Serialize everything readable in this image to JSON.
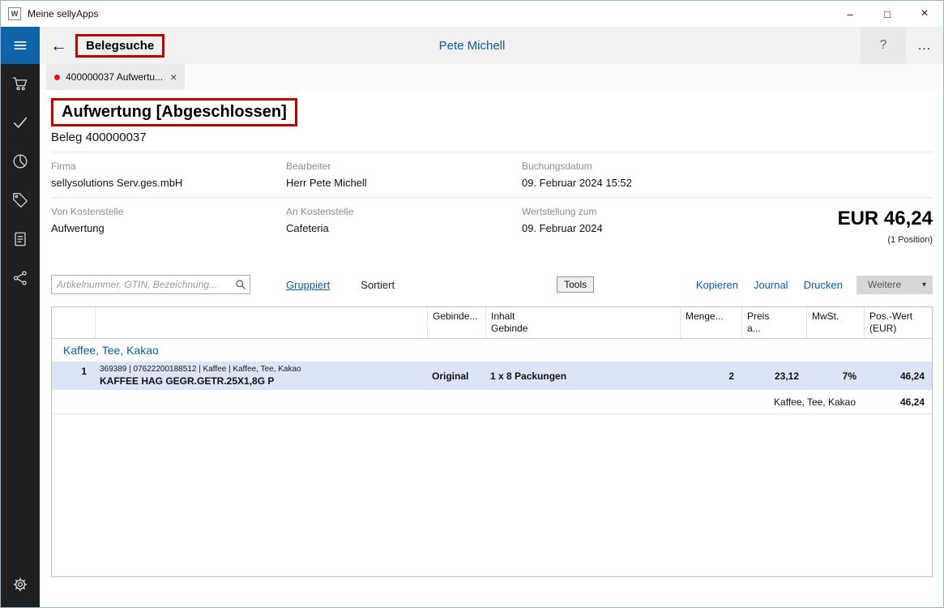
{
  "colors": {
    "accent_blue": "#0a5da6",
    "hamburger_bg": "#0f63a8",
    "sidebar_bg": "#1f1f1f",
    "row_highlight": "#dbe5f7",
    "annotation_red": "#c00000",
    "tab_dot_red": "#e81123"
  },
  "window": {
    "title": "Meine sellyApps",
    "icon_letter": "W",
    "minimize_glyph": "–",
    "maximize_glyph": "□",
    "close_glyph": "×"
  },
  "header": {
    "back_glyph": "←",
    "breadcrumb": "Belegsuche",
    "user_name": "Pete Michell",
    "help_glyph": "?",
    "more_glyph": "…"
  },
  "sidebar": {
    "icons": [
      "hamburger-menu",
      "shopping-cart",
      "checkmark",
      "pie-chart",
      "tag",
      "journal-book",
      "share-network",
      "settings-gear"
    ]
  },
  "tab": {
    "label": "400000037 Aufwertu...",
    "close_glyph": "×"
  },
  "document": {
    "title": "Aufwertung [Abgeschlossen]",
    "subtitle": "Beleg 400000037",
    "fields": [
      {
        "label": "Firma",
        "value": "sellysolutions Serv.ges.mbH"
      },
      {
        "label": "Bearbeiter",
        "value": "Herr Pete Michell"
      },
      {
        "label": "Buchungsdatum",
        "value": "09. Februar 2024 15:52"
      },
      {
        "label": "Von Kostenstelle",
        "value": "Aufwertung"
      },
      {
        "label": "An Kostenstelle",
        "value": "Cafeteria"
      },
      {
        "label": "Wertstellung zum",
        "value": "09. Februar 2024"
      }
    ],
    "total": "EUR 46,24",
    "total_note": "(1 Position)"
  },
  "toolbar": {
    "search_placeholder": "Artikelnummer, GTIN, Bezeichnung...",
    "grouped_label": "Gruppiert",
    "sorted_label": "Sortiert",
    "tools_label": "Tools",
    "copy_label": "Kopieren",
    "journal_label": "Journal",
    "print_label": "Drucken",
    "more_label": "Weitere",
    "chevron_glyph": "▾"
  },
  "table": {
    "headers": [
      "",
      "",
      "Gebinde...",
      "Inhalt\nGebinde",
      "Menge...",
      "Preis\na...",
      "MwSt.",
      "Pos.-Wert\n(EUR)"
    ],
    "group_label": "Kaffee, Tee, Kakao",
    "rows": [
      {
        "pos": "1",
        "meta": "369389 | 07622200188512 | Kaffee | Kaffee, Tee, Kakao",
        "name": "KAFFEE HAG GEGR.GETR.25X1,8G P",
        "gebinde": "Original",
        "inhalt": "1 x 8 Packungen",
        "menge": "2",
        "preis": "23,12",
        "mwst": "7%",
        "wert": "46,24"
      }
    ],
    "summary": {
      "label": "Kaffee, Tee, Kakao",
      "value": "46,24"
    }
  }
}
